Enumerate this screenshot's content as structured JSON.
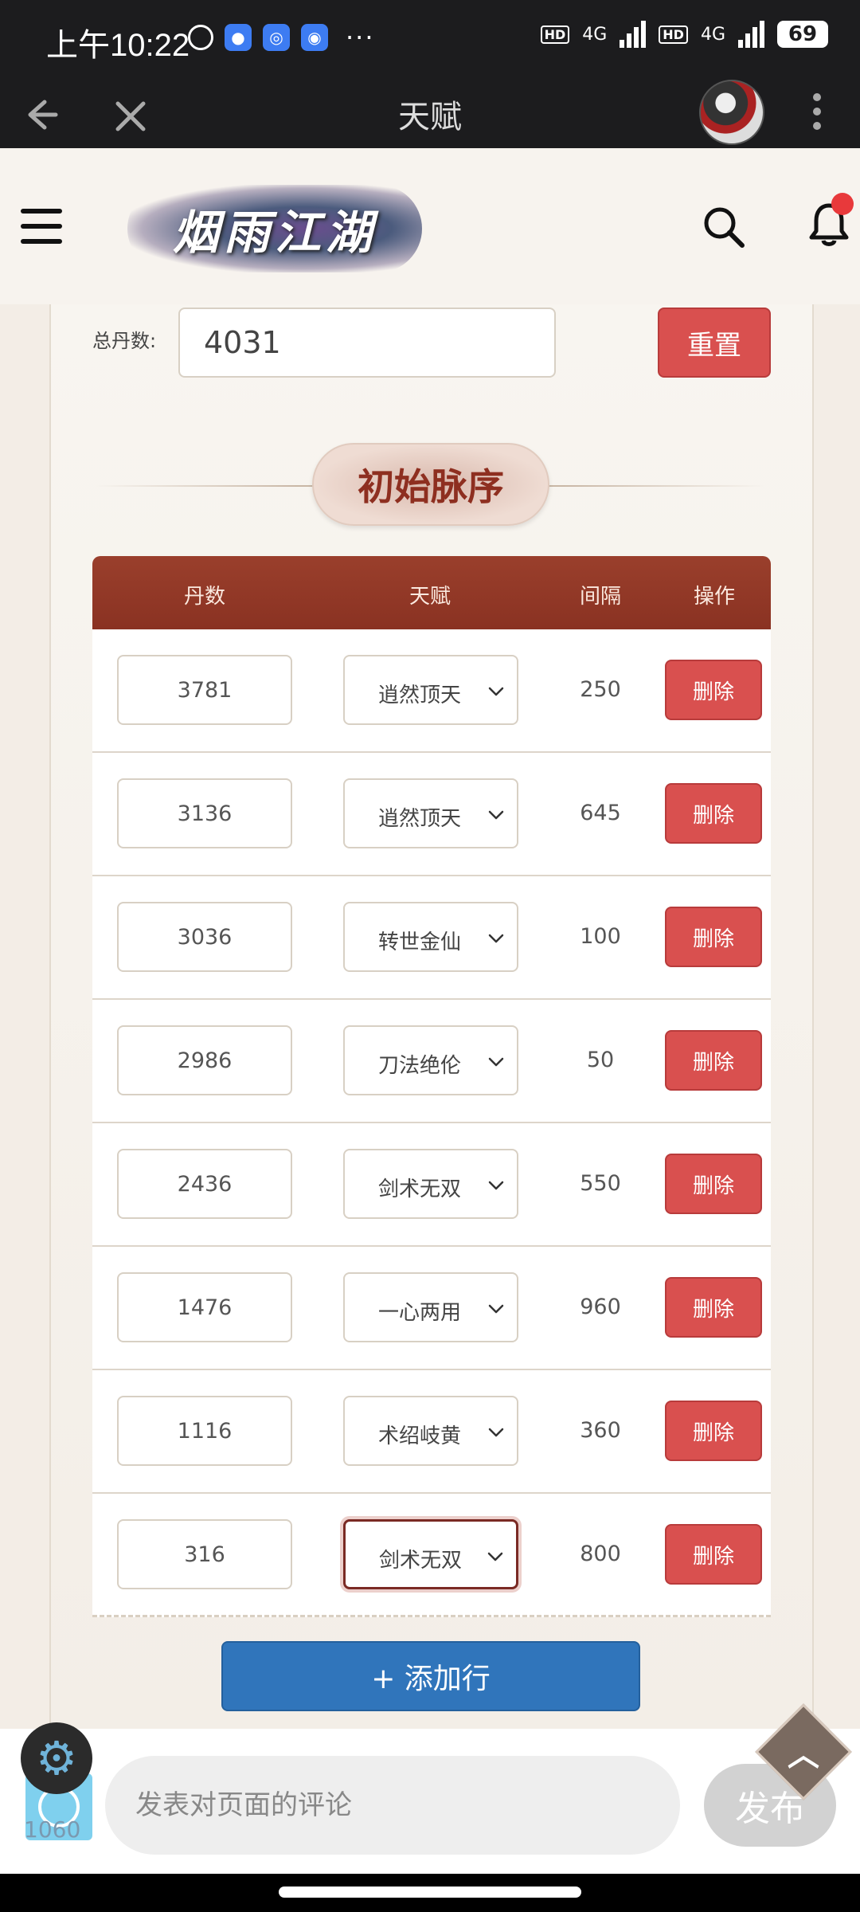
{
  "status_bar": {
    "time": "上午10:22",
    "network_1": "4G",
    "network_2": "4G",
    "battery": "69"
  },
  "browser": {
    "title": "天赋"
  },
  "site": {
    "logo_text": "烟雨江湖"
  },
  "form": {
    "total_label": "总丹数:",
    "total_value": "4031",
    "reset_label": "重置"
  },
  "section": {
    "title": "初始脉序"
  },
  "table": {
    "headers": [
      "丹数",
      "天赋",
      "间隔",
      "操作"
    ],
    "rows": [
      {
        "dan": "3781",
        "talent": "逍然顶天",
        "gap": "250",
        "action": "删除"
      },
      {
        "dan": "3136",
        "talent": "逍然顶天",
        "gap": "645",
        "action": "删除"
      },
      {
        "dan": "3036",
        "talent": "转世金仙",
        "gap": "100",
        "action": "删除"
      },
      {
        "dan": "2986",
        "talent": "刀法绝伦",
        "gap": "50",
        "action": "删除"
      },
      {
        "dan": "2436",
        "talent": "剑术无双",
        "gap": "550",
        "action": "删除"
      },
      {
        "dan": "1476",
        "talent": "一心两用",
        "gap": "960",
        "action": "删除"
      },
      {
        "dan": "1116",
        "talent": "术绍岐黄",
        "gap": "360",
        "action": "删除"
      },
      {
        "dan": "316",
        "talent": "剑术无双",
        "gap": "800",
        "action": "删除"
      }
    ]
  },
  "add_row_label": "+ 添加行",
  "comment": {
    "placeholder": "发表对页面的评论",
    "publish_label": "发布",
    "count": "1060"
  },
  "colors": {
    "accent_red": "#d9504f",
    "header_brown": "#8a3222",
    "add_blue": "#3075bb"
  }
}
